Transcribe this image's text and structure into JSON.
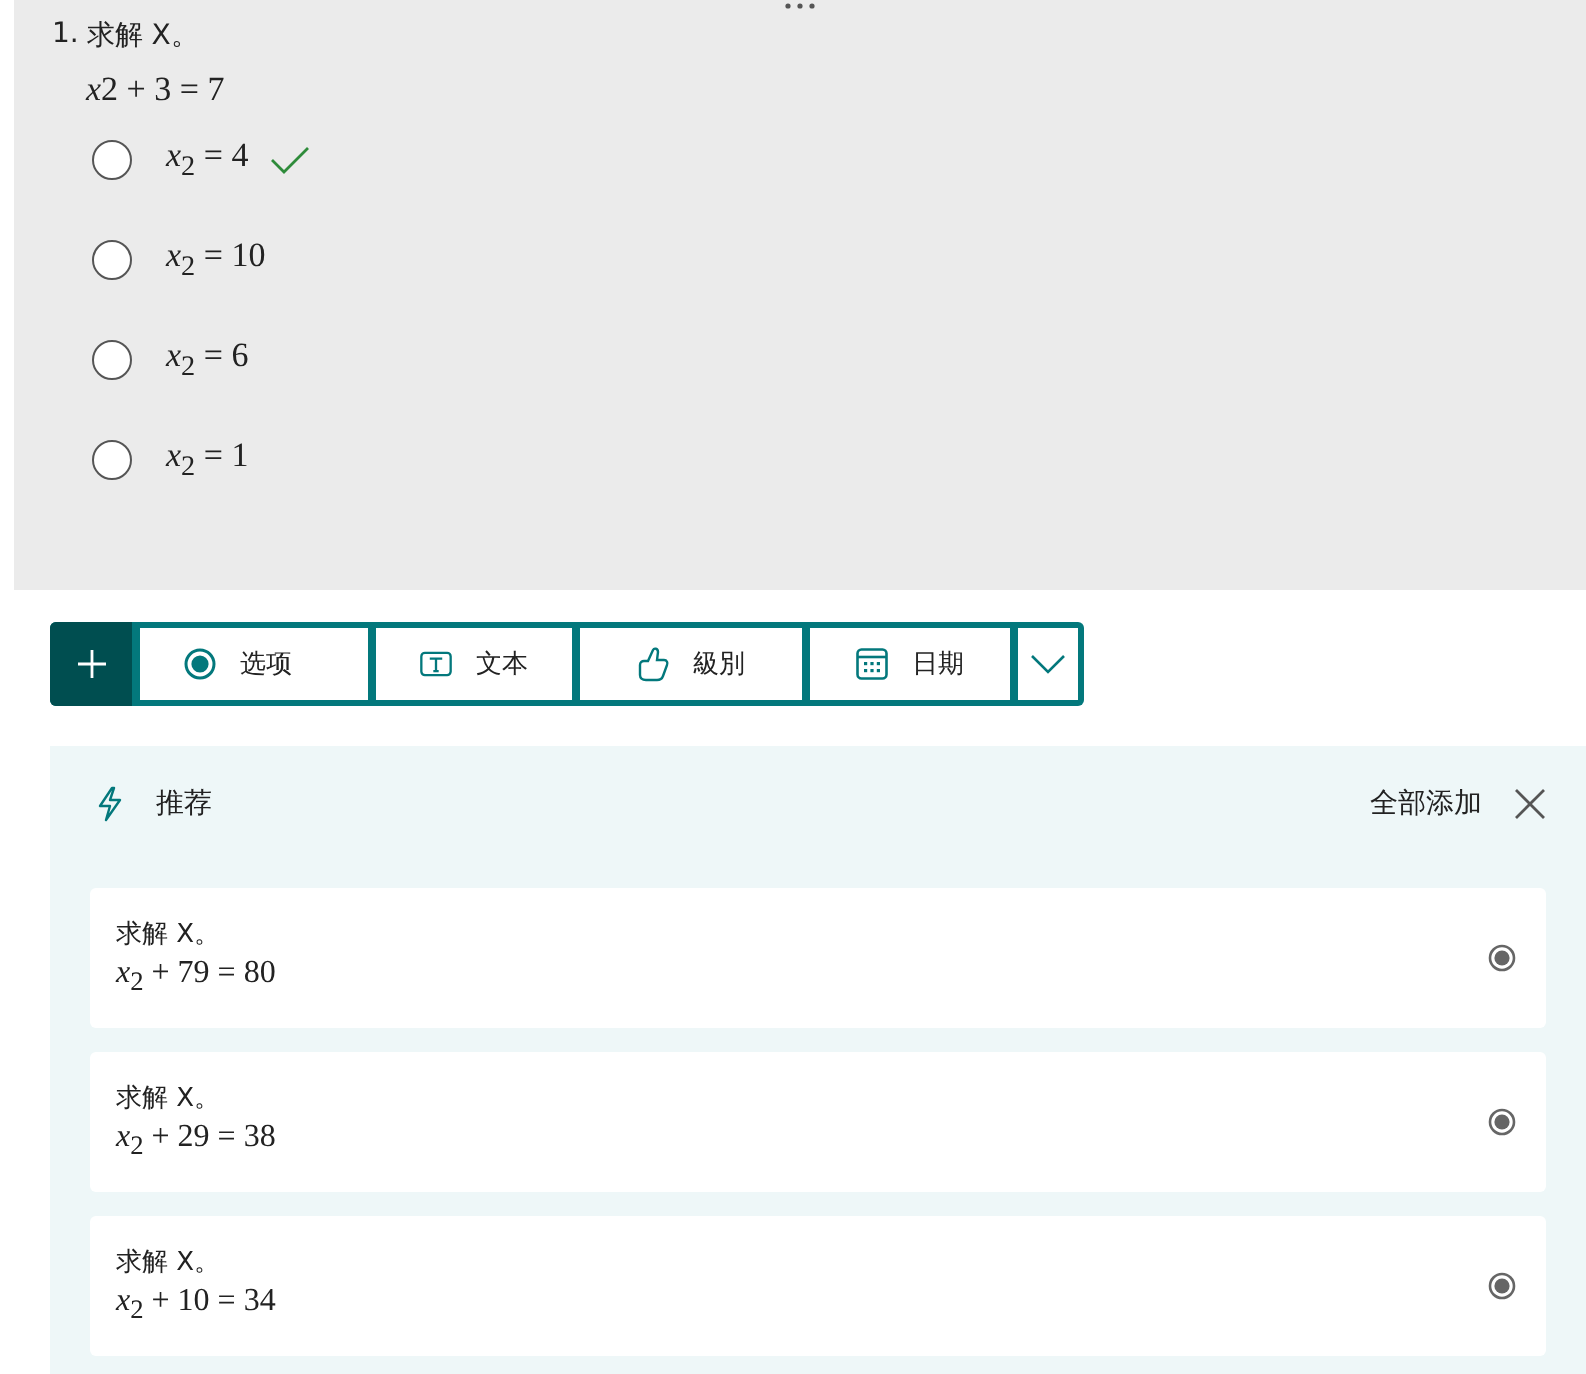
{
  "question": {
    "number": "1.",
    "title": "求解 X。",
    "equation_variable": "x",
    "equation": "2  + 3 = 7",
    "options": [
      {
        "text": "*x*$_{2}$ = 4",
        "correct": true,
        "selected": false
      },
      {
        "text": "*x*$_{2}$ = 10",
        "correct": false,
        "selected": false
      },
      {
        "text": "*x*$_{2}$ = 6",
        "correct": false,
        "selected": false
      },
      {
        "text": "*x*$_{2}$ = 1",
        "correct": false,
        "selected": false
      }
    ]
  },
  "toolbar": {
    "buttons": [
      {
        "kind": "choice",
        "label": "选项"
      },
      {
        "kind": "text",
        "label": "文本"
      },
      {
        "kind": "rating",
        "label": "級別"
      },
      {
        "kind": "date",
        "label": "日期"
      }
    ]
  },
  "suggestions": {
    "title": "推荐",
    "add_all": "全部添加",
    "items": [
      {
        "title": "求解 X。",
        "equation": "*x*$_{2}$ + 79 = 80"
      },
      {
        "title": "求解 X。",
        "equation": "*x*$_{2}$ + 29 = 38"
      },
      {
        "title": "求解 X。",
        "equation": "*x*$_{2}$ + 10 = 34"
      }
    ]
  }
}
